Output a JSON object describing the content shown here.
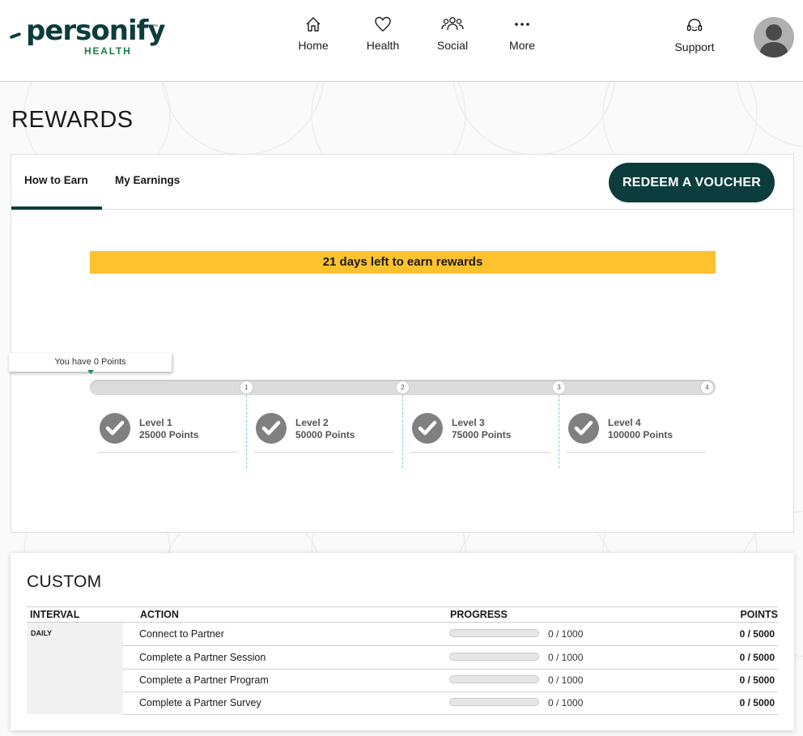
{
  "brand": {
    "name": "personify",
    "sub": "HEALTH",
    "tm": "™",
    "color": "#0c3d3d",
    "accent": "#1c7a4c"
  },
  "nav": {
    "home": "Home",
    "health": "Health",
    "social": "Social",
    "more": "More",
    "support": "Support"
  },
  "page": {
    "title": "REWARDS"
  },
  "tabs": {
    "how_to_earn": "How to Earn",
    "my_earnings": "My Earnings",
    "active": "How to Earn"
  },
  "voucher_button": "REDEEM A VOUCHER",
  "deadline_banner": "21 days left to earn rewards",
  "points_tooltip": "You have 0 Points",
  "progress": {
    "current_points": 0,
    "max_points": 100000
  },
  "track_nodes": [
    "1",
    "2",
    "3",
    "4"
  ],
  "levels": [
    {
      "name": "Level 1",
      "points": "25000 Points"
    },
    {
      "name": "Level 2",
      "points": "50000 Points"
    },
    {
      "name": "Level 3",
      "points": "75000 Points"
    },
    {
      "name": "Level 4",
      "points": "100000 Points"
    }
  ],
  "custom": {
    "title": "CUSTOM",
    "columns": {
      "interval": "INTERVAL",
      "action": "ACTION",
      "progress": "PROGRESS",
      "points": "POINTS"
    },
    "interval": "DAILY",
    "rows": [
      {
        "action": "Connect to Partner",
        "progress": "0 / 1000",
        "progress_fraction": 0,
        "points": "0 / 5000"
      },
      {
        "action": "Complete a Partner Session",
        "progress": "0 / 1000",
        "progress_fraction": 0,
        "points": "0 / 5000"
      },
      {
        "action": "Complete a Partner Program",
        "progress": "0 / 1000",
        "progress_fraction": 0,
        "points": "0 / 5000"
      },
      {
        "action": "Complete a Partner Survey",
        "progress": "0 / 1000",
        "progress_fraction": 0,
        "points": "0 / 5000"
      }
    ]
  },
  "colors": {
    "primary": "#0c3d3d",
    "banner": "#fdc22e",
    "completed_check": "#808080"
  }
}
